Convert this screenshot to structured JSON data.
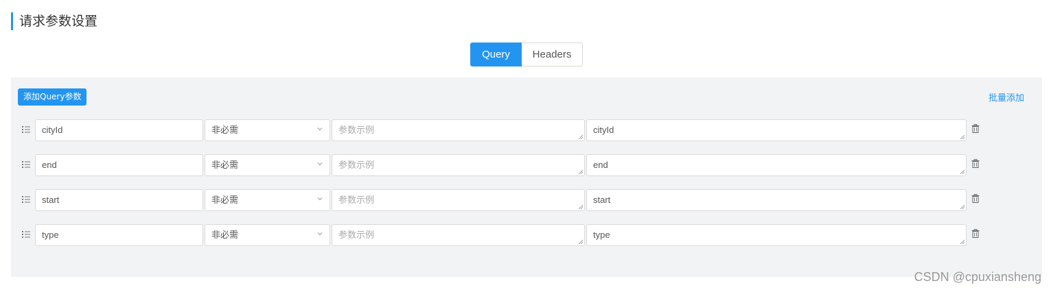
{
  "section": {
    "title": "请求参数设置"
  },
  "tabs": [
    {
      "label": "Query",
      "active": true
    },
    {
      "label": "Headers",
      "active": false
    }
  ],
  "toolbar": {
    "add_button_label": "添加Query参数",
    "bulk_add_label": "批量添加"
  },
  "params": [
    {
      "name": "cityId",
      "required": "非必需",
      "example_placeholder": "参数示例",
      "desc": "cityId"
    },
    {
      "name": "end",
      "required": "非必需",
      "example_placeholder": "参数示例",
      "desc": "end"
    },
    {
      "name": "start",
      "required": "非必需",
      "example_placeholder": "参数示例",
      "desc": "start"
    },
    {
      "name": "type",
      "required": "非必需",
      "example_placeholder": "参数示例",
      "desc": "type"
    }
  ],
  "watermark": "CSDN @cpuxiansheng",
  "colors": {
    "accent": "#2395f1",
    "panel_bg": "#f2f3f5",
    "border": "#d9d9d9"
  },
  "icons": {
    "drag": "list-drag-icon",
    "caret": "chevron-down-icon",
    "delete": "trash-icon"
  }
}
